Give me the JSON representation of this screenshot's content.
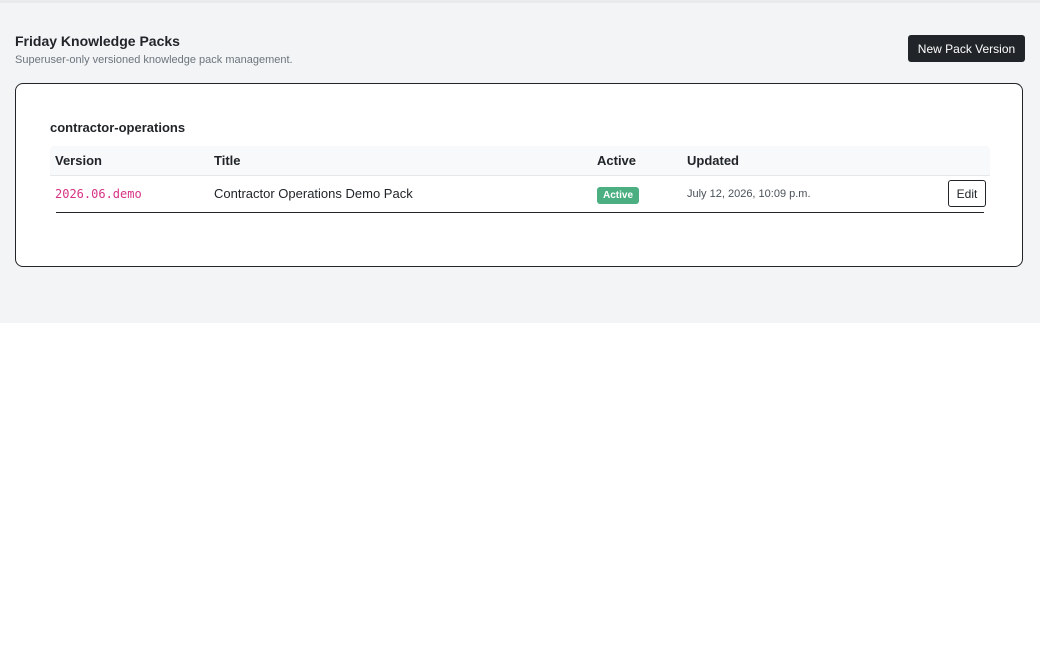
{
  "header": {
    "title": "Friday Knowledge Packs",
    "subtitle": "Superuser-only versioned knowledge pack management.",
    "new_pack_button": "New Pack Version"
  },
  "pack": {
    "name": "contractor-operations",
    "columns": {
      "version": "Version",
      "title": "Title",
      "active": "Active",
      "updated": "Updated"
    },
    "rows": [
      {
        "version": "2026.06.demo",
        "title": "Contractor Operations Demo Pack",
        "active_badge": "Active",
        "updated": "July 12, 2026, 10:09 p.m.",
        "edit_label": "Edit"
      }
    ]
  },
  "colors": {
    "primary_button": "#212529",
    "badge_active": "#4caf82",
    "version_code": "#d63384",
    "page_background": "#f3f4f6"
  }
}
